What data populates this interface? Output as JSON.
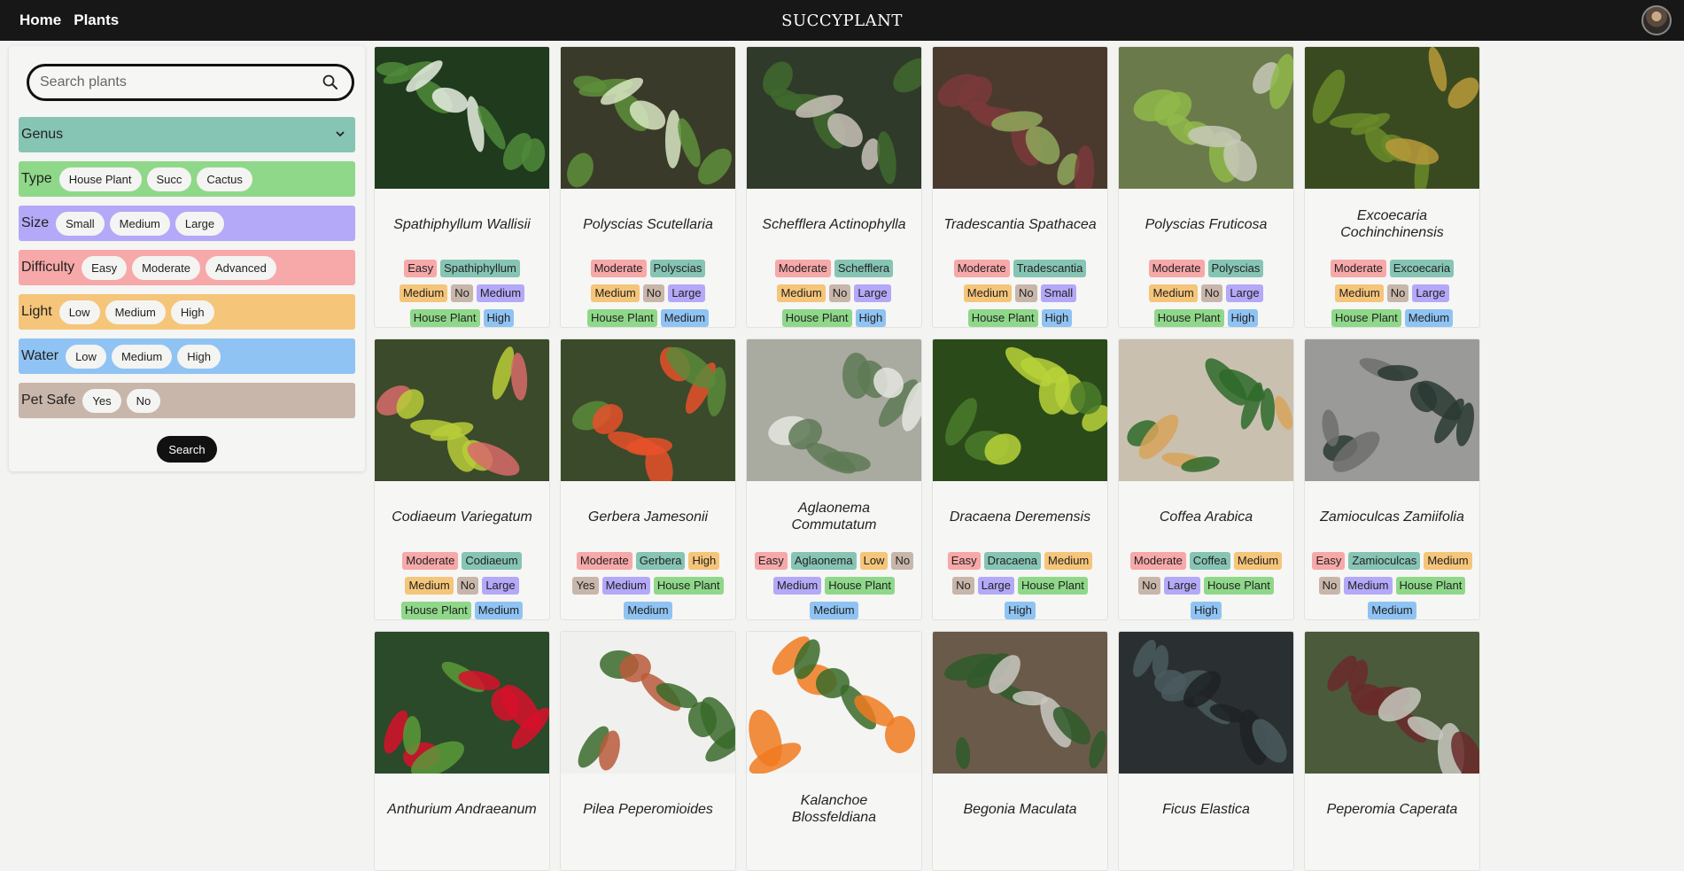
{
  "nav": {
    "home": "Home",
    "plants": "Plants",
    "brand": "SUCCYPLANT"
  },
  "sidebar": {
    "search_placeholder": "Search plants",
    "search_button": "Search",
    "genus_label": "Genus",
    "type": {
      "label": "Type",
      "options": [
        "House Plant",
        "Succ",
        "Cactus"
      ]
    },
    "size": {
      "label": "Size",
      "options": [
        "Small",
        "Medium",
        "Large"
      ]
    },
    "difficulty": {
      "label": "Difficulty",
      "options": [
        "Easy",
        "Moderate",
        "Advanced"
      ]
    },
    "light": {
      "label": "Light",
      "options": [
        "Low",
        "Medium",
        "High"
      ]
    },
    "water": {
      "label": "Water",
      "options": [
        "Low",
        "Medium",
        "High"
      ]
    },
    "pet_safe": {
      "label": "Pet Safe",
      "options": [
        "Yes",
        "No"
      ]
    }
  },
  "colors": {
    "genus": "#86c4b4",
    "type": "#8fd88a",
    "size": "#b4a8f8",
    "difficulty": "#f7a8a8",
    "light": "#f5c57a",
    "water": "#8fc3f3",
    "pet_safe": "#c8b6aa"
  },
  "plants": [
    {
      "name": "Spathiphyllum Wallisii",
      "tags": [
        [
          "diff",
          "Easy"
        ],
        [
          "genus",
          "Spathiphyllum"
        ],
        [
          "light",
          "Medium"
        ],
        [
          "pet",
          "No"
        ],
        [
          "size",
          "Medium"
        ],
        [
          "type",
          "House Plant"
        ],
        [
          "water",
          "High"
        ]
      ]
    },
    {
      "name": "Polyscias Scutellaria",
      "tags": [
        [
          "diff",
          "Moderate"
        ],
        [
          "genus",
          "Polyscias"
        ],
        [
          "light",
          "Medium"
        ],
        [
          "pet",
          "No"
        ],
        [
          "size",
          "Large"
        ],
        [
          "type",
          "House Plant"
        ],
        [
          "water",
          "Medium"
        ]
      ]
    },
    {
      "name": "Schefflera Actinophylla",
      "tags": [
        [
          "diff",
          "Moderate"
        ],
        [
          "genus",
          "Schefflera"
        ],
        [
          "light",
          "Medium"
        ],
        [
          "pet",
          "No"
        ],
        [
          "size",
          "Large"
        ],
        [
          "type",
          "House Plant"
        ],
        [
          "water",
          "High"
        ]
      ]
    },
    {
      "name": "Tradescantia Spathacea",
      "tags": [
        [
          "diff",
          "Moderate"
        ],
        [
          "genus",
          "Tradescantia"
        ],
        [
          "light",
          "Medium"
        ],
        [
          "pet",
          "No"
        ],
        [
          "size",
          "Small"
        ],
        [
          "type",
          "House Plant"
        ],
        [
          "water",
          "High"
        ]
      ]
    },
    {
      "name": "Polyscias Fruticosa",
      "tags": [
        [
          "diff",
          "Moderate"
        ],
        [
          "genus",
          "Polyscias"
        ],
        [
          "light",
          "Medium"
        ],
        [
          "pet",
          "No"
        ],
        [
          "size",
          "Large"
        ],
        [
          "type",
          "House Plant"
        ],
        [
          "water",
          "High"
        ]
      ]
    },
    {
      "name": "Excoecaria Cochinchinensis",
      "tags": [
        [
          "diff",
          "Moderate"
        ],
        [
          "genus",
          "Excoecaria"
        ],
        [
          "light",
          "Medium"
        ],
        [
          "pet",
          "No"
        ],
        [
          "size",
          "Large"
        ],
        [
          "type",
          "House Plant"
        ],
        [
          "water",
          "Medium"
        ]
      ]
    },
    {
      "name": "Codiaeum Variegatum",
      "tags": [
        [
          "diff",
          "Moderate"
        ],
        [
          "genus",
          "Codiaeum"
        ],
        [
          "light",
          "Medium"
        ],
        [
          "pet",
          "No"
        ],
        [
          "size",
          "Large"
        ],
        [
          "type",
          "House Plant"
        ],
        [
          "water",
          "Medium"
        ]
      ]
    },
    {
      "name": "Gerbera Jamesonii",
      "tags": [
        [
          "diff",
          "Moderate"
        ],
        [
          "genus",
          "Gerbera"
        ],
        [
          "light",
          "High"
        ],
        [
          "pet",
          "Yes"
        ],
        [
          "size",
          "Medium"
        ],
        [
          "type",
          "House Plant"
        ],
        [
          "water",
          "Medium"
        ]
      ]
    },
    {
      "name": "Aglaonema Commutatum",
      "tags": [
        [
          "diff",
          "Easy"
        ],
        [
          "genus",
          "Aglaonema"
        ],
        [
          "light",
          "Low"
        ],
        [
          "pet",
          "No"
        ],
        [
          "size",
          "Medium"
        ],
        [
          "type",
          "House Plant"
        ],
        [
          "water",
          "Medium"
        ]
      ]
    },
    {
      "name": "Dracaena Deremensis",
      "tags": [
        [
          "diff",
          "Easy"
        ],
        [
          "genus",
          "Dracaena"
        ],
        [
          "light",
          "Medium"
        ],
        [
          "pet",
          "No"
        ],
        [
          "size",
          "Large"
        ],
        [
          "type",
          "House Plant"
        ],
        [
          "water",
          "High"
        ]
      ]
    },
    {
      "name": "Coffea Arabica",
      "tags": [
        [
          "diff",
          "Moderate"
        ],
        [
          "genus",
          "Coffea"
        ],
        [
          "light",
          "Medium"
        ],
        [
          "pet",
          "No"
        ],
        [
          "size",
          "Large"
        ],
        [
          "type",
          "House Plant"
        ],
        [
          "water",
          "High"
        ]
      ]
    },
    {
      "name": "Zamioculcas Zamiifolia",
      "tags": [
        [
          "diff",
          "Easy"
        ],
        [
          "genus",
          "Zamioculcas"
        ],
        [
          "light",
          "Medium"
        ],
        [
          "pet",
          "No"
        ],
        [
          "size",
          "Medium"
        ],
        [
          "type",
          "House Plant"
        ],
        [
          "water",
          "Medium"
        ]
      ]
    },
    {
      "name": "Anthurium Andraeanum",
      "tags": []
    },
    {
      "name": "Pilea Peperomioides",
      "tags": []
    },
    {
      "name": "Kalanchoe Blossfeldiana",
      "tags": []
    },
    {
      "name": "Begonia Maculata",
      "tags": []
    },
    {
      "name": "Ficus Elastica",
      "tags": []
    },
    {
      "name": "Peperomia Caperata",
      "tags": []
    }
  ]
}
